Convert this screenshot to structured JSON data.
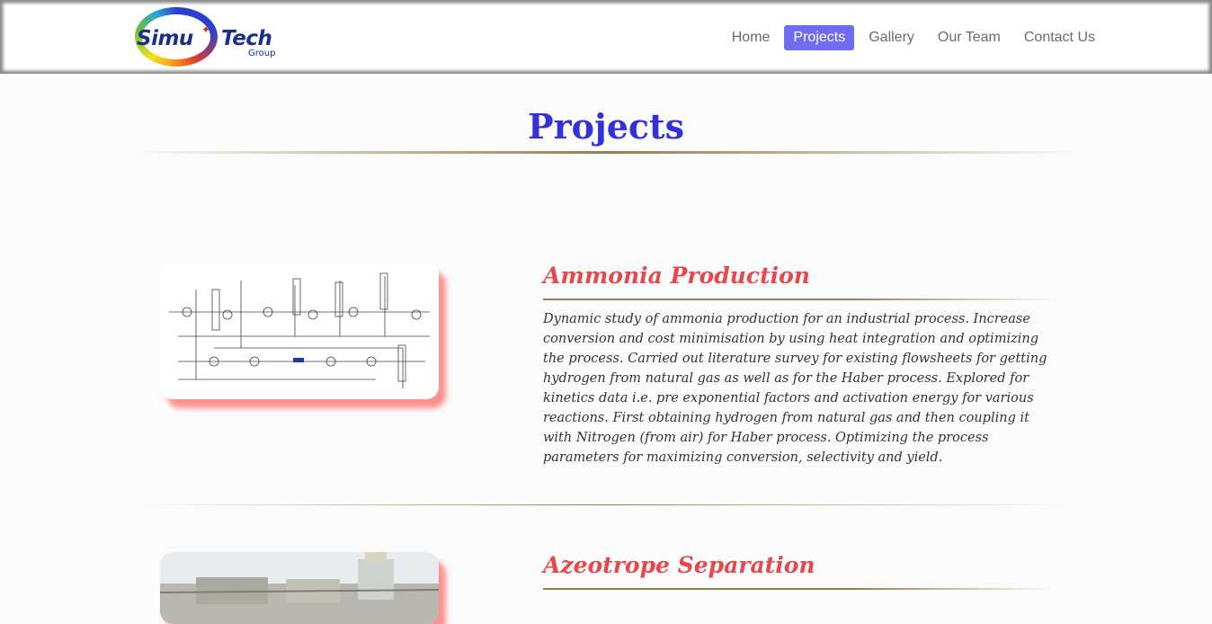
{
  "header": {
    "logo": {
      "word1": "Simu",
      "word2": "Tech",
      "sub": "Group"
    },
    "nav": [
      "Home",
      "Projects",
      "Gallery",
      "Our Team",
      "Contact Us"
    ],
    "active_nav": "Projects"
  },
  "main": {
    "title": "Projects",
    "projects": [
      {
        "title": "Ammonia Production",
        "description": "Dynamic study of ammonia production for an industrial process. Increase conversion and cost minimisation by using heat integration and optimizing the process. Carried out literature survey for existing flowsheets for getting hydrogen from natural gas as well as for the Haber process. Explored for kinetics data i.e. pre exponential factors and activation energy for various reactions. First obtaining hydrogen from natural gas and then coupling it with Nitrogen (from air) for Haber process. Optimizing the process parameters for maximizing conversion, selectivity and yield."
      },
      {
        "title": "Azeotrope Separation"
      }
    ]
  },
  "colors": {
    "accent_blue": "#3431d6",
    "nav_active": "#6f6cf2",
    "project_title": "#e5484d",
    "rule": "#8c8250"
  }
}
